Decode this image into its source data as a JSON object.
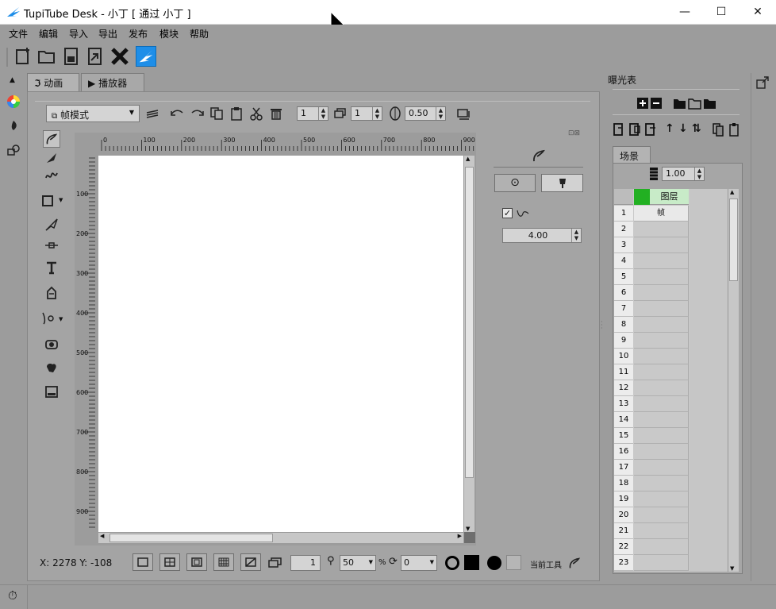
{
  "window": {
    "title": "TupiTube Desk - 小丁 [ 通过 小丁 ]",
    "controls": {
      "minimize": "—",
      "maximize": "☐",
      "close": "✕"
    }
  },
  "menu": [
    "文件",
    "编辑",
    "导入",
    "导出",
    "发布",
    "模块",
    "帮助"
  ],
  "tabs": {
    "animation": "动画",
    "player": "播放器"
  },
  "toolbar": {
    "mode": "帧模式",
    "spin_frame": "1",
    "spin_layer": "1",
    "spin_opacity": "0.50"
  },
  "ruler": {
    "h_ticks": [
      "0",
      "100",
      "200",
      "300",
      "400",
      "500",
      "600",
      "700",
      "800",
      "900"
    ],
    "v_ticks": [
      "100",
      "200",
      "300",
      "400",
      "500",
      "600",
      "700",
      "800",
      "900"
    ]
  },
  "tool_props": {
    "smooth_value": "4.00",
    "checked": true
  },
  "exposure": {
    "title": "曝光表",
    "scene_tab": "场景",
    "fps": "1.00",
    "layer_name": "图层",
    "first_frame": "帧",
    "rows": [
      "1",
      "2",
      "3",
      "4",
      "5",
      "6",
      "7",
      "8",
      "9",
      "10",
      "11",
      "12",
      "13",
      "14",
      "15",
      "16",
      "17",
      "18",
      "19",
      "20",
      "21",
      "22",
      "23"
    ]
  },
  "statusbar": {
    "coords": "X: 2278 Y: -108",
    "frame_value": "1",
    "zoom": "50",
    "zoom_unit": "%",
    "rotation": "0",
    "current_tool_label": "当前工具"
  },
  "colors": {
    "accent": "#1e8ee8",
    "layer_color": "#22b022",
    "layer_header": "#c8ebc8"
  }
}
